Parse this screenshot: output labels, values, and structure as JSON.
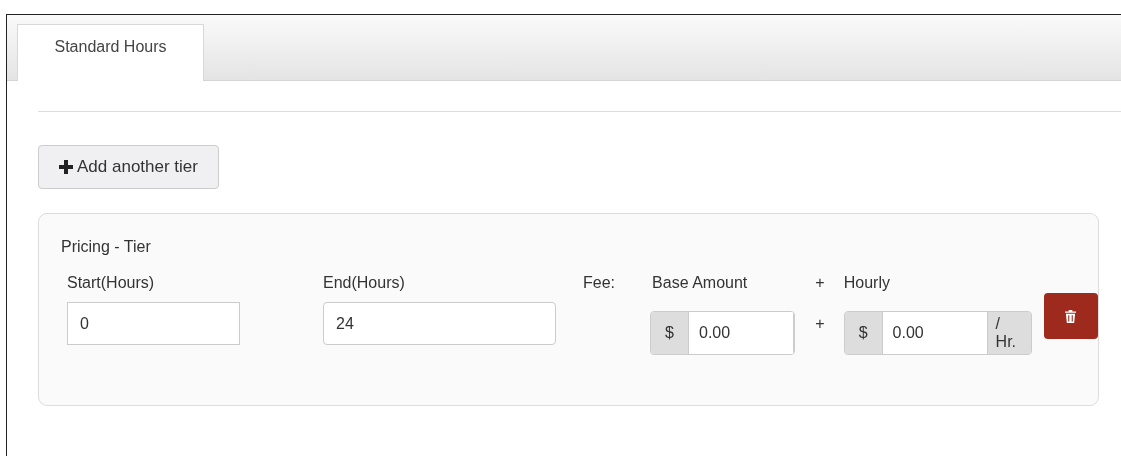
{
  "tabs": [
    {
      "label": "Standard Hours",
      "selected": true
    }
  ],
  "add_button": {
    "label": "Add another tier"
  },
  "tier": {
    "title": "Pricing - Tier",
    "start": {
      "label": "Start(Hours)",
      "value": "0"
    },
    "end": {
      "label": "End(Hours)",
      "value": "24"
    },
    "fee": {
      "label": "Fee:",
      "base_label": "Base Amount",
      "label_plus": "+",
      "hourly_label": "Hourly",
      "input_plus": "+",
      "base": {
        "prefix": "$",
        "value": "0.00"
      },
      "hourly": {
        "prefix": "$",
        "value": "0.00",
        "suffix": "/ Hr."
      }
    }
  }
}
